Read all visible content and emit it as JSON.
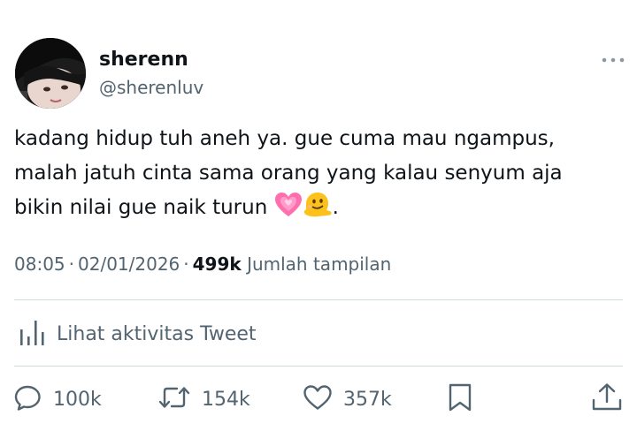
{
  "user": {
    "name": "sherenn",
    "handle": "@sherenluv"
  },
  "tweet": {
    "lines": [
      "kadang hidup tuh aneh ya. gue cuma mau ngampus,",
      "malah jatuh cinta sama orang yang kalau senyum aja",
      "bikin nilai gue naik turun "
    ],
    "emojis": [
      "growing-heart",
      "melting-face"
    ],
    "trailing": "."
  },
  "meta": {
    "time": "08:05",
    "date": "02/01/2026",
    "separator": "·",
    "views_count": "499k",
    "views_label": "Jumlah tampilan"
  },
  "activity": {
    "label": "Lihat aktivitas Tweet"
  },
  "actions": {
    "replies": "100k",
    "retweets": "154k",
    "likes": "357k"
  },
  "colors": {
    "text": "#0f1419",
    "secondary": "#536471",
    "divider": "#cfd9de",
    "heart_emoji": "#ff6fae",
    "melting_emoji": "#fcc21b"
  }
}
